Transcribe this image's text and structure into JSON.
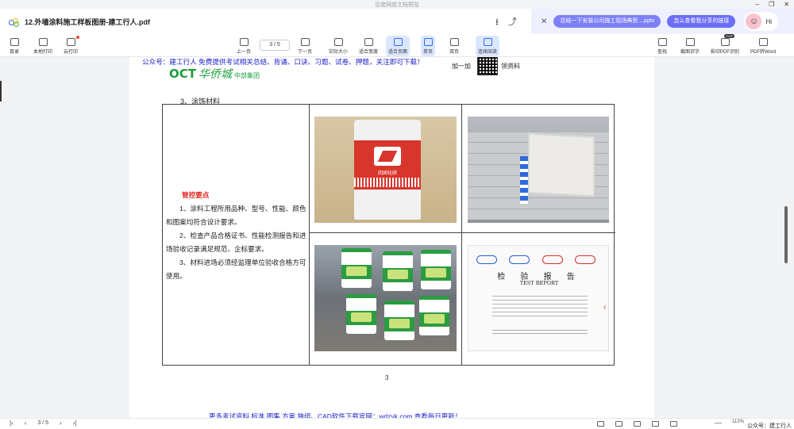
{
  "window": {
    "caption": "百度网盘文档预览",
    "minimize": "–",
    "restore": "❐",
    "close": "✕"
  },
  "doc": {
    "filename": "12.外墙涂料施工样板图册-建工行人.pdf",
    "download_icon": "⭳",
    "share_icon": "⤴"
  },
  "ai_panel": {
    "close": "✕",
    "chip1": "总结一下安装公司施工现场典型....pptx",
    "chip2": "怎么查看我分享的链接",
    "hi": "Hi",
    "face": "☺"
  },
  "toolbar": {
    "catalog": "目录",
    "local_print": "本地打印",
    "cloud_print": "云打印",
    "prev": "上一页",
    "page_indicator": "3 / 5",
    "next": "下一页",
    "actual_size": "实际大小",
    "fit_width": "适合宽度",
    "fit_page": "适合页面",
    "single": "单页",
    "double": "双页",
    "continuous": "连续阅读",
    "search": "查找",
    "ocr": "截图识字",
    "pdf_ocr": "影印PDF识别",
    "new_badge": "SVIP",
    "pdf_word": "PDF转Word"
  },
  "page": {
    "gzh": "公众号：建工行人 免费提供考试相关总结、背诵、口诀、习题、试卷、押题，关注即可下载！",
    "brand_oct": "OCT",
    "brand_hua": "华侨城",
    "brand_group": "中部集团",
    "jiayi": "加一加",
    "lingzi": "领资料",
    "section": "3、涂饰材料",
    "control_title": "管控要点",
    "point1": "1、涂料工程所用品种、型号、性能、颜色和图案均符合设计要求。",
    "point2": "2、检查产品合格证书、性能检测报告和进场验收记录满足规范、企标要求。",
    "point3": "3、材料进场必须经监理单位验收合格方可使用。",
    "photo1_cn": "四国化研",
    "report_title": "检 验 报 告",
    "report_sub": "TEST REPORT",
    "report_chevron": "‹",
    "page_number": "3",
    "footer": "更多考试资料 标准 图集 方案 施组、CAD软件下载官网：wdzyk.com 查看每日更新！"
  },
  "status": {
    "first": "|‹",
    "prev": "‹",
    "page": "3 / 5",
    "next": "›",
    "last": "›|",
    "minus": "—",
    "zoom": "113%",
    "watermark": "公众号：建工行人"
  }
}
